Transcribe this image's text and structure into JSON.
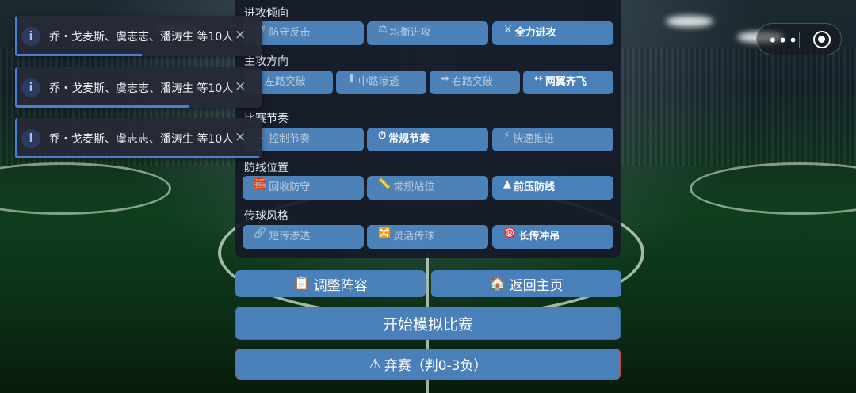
{
  "sections": [
    {
      "title": "进攻倾向",
      "options": [
        {
          "icon": "🛡",
          "label": "防守反击",
          "selected": false
        },
        {
          "icon": "⚖",
          "label": "均衡进攻",
          "selected": false
        },
        {
          "icon": "⚔",
          "label": "全力进攻",
          "selected": true
        }
      ]
    },
    {
      "title": "主攻方向",
      "options": [
        {
          "icon": "⬅",
          "label": "左路突破",
          "selected": false
        },
        {
          "icon": "⬆",
          "label": "中路渗透",
          "selected": false
        },
        {
          "icon": "➡",
          "label": "右路突破",
          "selected": false
        },
        {
          "icon": "↔",
          "label": "两翼齐飞",
          "selected": true
        }
      ]
    },
    {
      "title": "比赛节奏",
      "options": [
        {
          "icon": "⏳",
          "label": "控制节奏",
          "selected": false
        },
        {
          "icon": "⏱",
          "label": "常规节奏",
          "selected": true
        },
        {
          "icon": "⚡",
          "label": "快速推进",
          "selected": false
        }
      ]
    },
    {
      "title": "防线位置",
      "options": [
        {
          "icon": "🧱",
          "label": "回收防守",
          "selected": false
        },
        {
          "icon": "📏",
          "label": "常规站位",
          "selected": false
        },
        {
          "icon": "▲",
          "label": "前压防线",
          "selected": true
        }
      ]
    },
    {
      "title": "传球风格",
      "options": [
        {
          "icon": "🔗",
          "label": "短传渗透",
          "selected": false
        },
        {
          "icon": "🔀",
          "label": "灵活传球",
          "selected": false
        },
        {
          "icon": "🎯",
          "label": "长传冲吊",
          "selected": true
        }
      ]
    }
  ],
  "buttons": {
    "adjust": {
      "icon": "📋",
      "label": "调整阵容"
    },
    "home": {
      "icon": "🏠",
      "label": "返回主页"
    },
    "start": {
      "label": "开始模拟比赛"
    },
    "forfeit": {
      "icon": "⚠",
      "label": "弃赛（判0-3负）"
    }
  },
  "toasts": [
    {
      "icon": "i",
      "message": "乔・戈麦斯、虞志志、潘涛生 等10人",
      "close": "×",
      "progress": 0.5
    },
    {
      "icon": "i",
      "message": "乔・戈麦斯、虞志志、潘涛生 等10人",
      "close": "×",
      "progress": 0.7
    },
    {
      "icon": "i",
      "message": "乔・戈麦斯、虞志志、潘涛生 等10人",
      "close": "×",
      "progress": 0.99
    }
  ],
  "capsule": {
    "more": "•••"
  },
  "colors": {
    "button": "#4a80b9",
    "panel": "#161a28",
    "toast": "#262a36",
    "accent": "#4a7fd4",
    "forfeit_border": "#c94a3c"
  }
}
